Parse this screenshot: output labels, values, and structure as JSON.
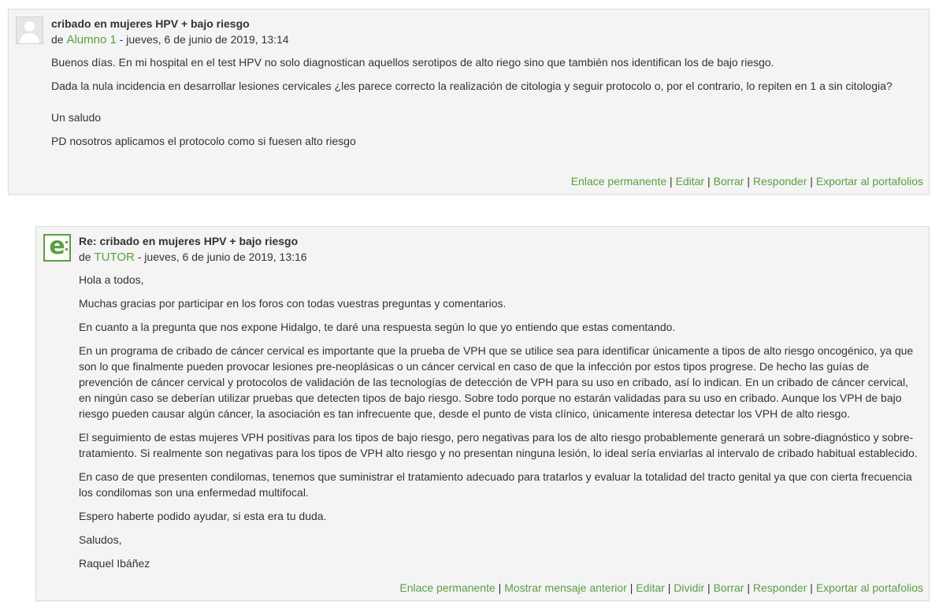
{
  "post1": {
    "subject": "cribado en mujeres HPV + bajo riesgo",
    "by": "de",
    "author": "Alumno 1",
    "date": "- jueves, 6 de junio de 2019, 13:14",
    "paragraphs": [
      "Buenos días. En mi  hospital en el test HPV no solo diagnostican aquellos serotipos de alto riego sino que también nos identifican los de bajo riesgo.",
      "Dada la nula incidencia en desarrollar lesiones cervicales ¿les  parece  correcto la realización de citologia y seguir protocolo o, por el contrario, lo repiten en 1 a sin citologia?",
      "Un  saludo",
      "PD  nosotros  aplicamos el protocolo como si fuesen alto riesgo"
    ],
    "commands": {
      "permalink": "Enlace permanente",
      "edit": "Editar",
      "delete": "Borrar",
      "reply": "Responder",
      "export": "Exportar al portafolios",
      "separator": "|"
    }
  },
  "post2": {
    "subject": "Re: cribado en mujeres HPV + bajo riesgo",
    "by": "de",
    "author": "TUTOR",
    "date": "- jueves, 6 de junio de 2019, 13:16",
    "avatar_text": "e",
    "paragraphs": [
      "Hola a todos,",
      "Muchas gracias por participar en los foros con todas vuestras preguntas y comentarios.",
      "En cuanto a la pregunta que nos expone Hidalgo, te daré una respuesta según lo que yo entiendo que estas comentando.",
      "En un programa de cribado de cáncer cervical es importante que la prueba de VPH que se utilice sea para identificar únicamente a tipos de alto riesgo oncogénico, ya que son lo que finalmente pueden provocar lesiones pre-neoplásicas o un cáncer cervical en caso de que la infección por estos tipos progrese. De hecho las guías de prevención de cáncer cervical y protocolos de validación de las tecnologías de detección de VPH para su uso en cribado, así lo indican. En un cribado de cáncer cervical, en ningún caso se deberían utilizar pruebas que detecten tipos de bajo riesgo. Sobre todo porque no estarán validadas para su uso en cribado. Aunque los VPH de bajo riesgo pueden causar algún cáncer, la asociación es tan infrecuente que, desde el punto de vista clínico, únicamente interesa detectar los VPH de alto riesgo.",
      "El seguimiento de estas mujeres VPH positivas para los tipos de bajo riesgo, pero negativas para los de alto riesgo probablemente generará un sobre-diagnóstico y sobre-tratamiento. Si realmente son negativas para los tipos de VPH alto riesgo y no presentan ninguna lesión, lo ideal sería enviarlas al intervalo de cribado habitual establecido.",
      "En caso de que presenten condilomas, tenemos que suministrar el tratamiento adecuado para tratarlos y evaluar la totalidad del tracto genital ya que con cierta frecuencia los condilomas son una enfermedad multifocal.",
      "Espero haberte podido ayudar, si esta era tu duda.",
      "Saludos,",
      "Raquel Ibáñez"
    ],
    "commands": {
      "permalink": "Enlace permanente",
      "show_parent": "Mostrar mensaje anterior",
      "edit": "Editar",
      "split": "Dividir",
      "delete": "Borrar",
      "reply": "Responder",
      "export": "Exportar al portafolios",
      "separator": "|"
    }
  },
  "colors": {
    "link": "#5aa03c",
    "text": "#333333",
    "post_bg": "#f4f4f4",
    "border": "#dddddd"
  }
}
